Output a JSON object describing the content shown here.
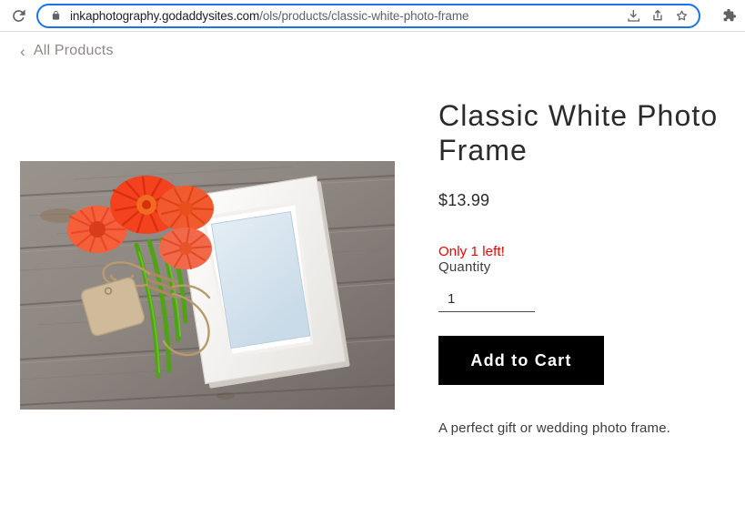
{
  "browser": {
    "reload_icon": "reload-icon",
    "lock_icon": "lock-icon",
    "url_domain": "inkaphotography.godaddysites.com",
    "url_path": "/ols/products/classic-white-photo-frame",
    "url_full": "inkaphotography.godaddysites.com/ols/products/classic-white-photo-frame",
    "download_icon": "download-icon",
    "share_icon": "share-icon",
    "bookmark_icon": "bookmark-star-icon",
    "extensions_icon": "extensions-puzzle-icon",
    "omnibox_focus_color": "#1a73e8"
  },
  "page": {
    "breadcrumb": {
      "chevron": "‹",
      "label": "All Products"
    },
    "product": {
      "image_alt": "Classic white photo frame on weathered gray wood with orange gerbera flowers and a kraft gift tag",
      "title": "Classic White Photo Frame",
      "price": "$13.99",
      "stock_status": "Only 1 left!",
      "stock_status_color": "#ef0000",
      "quantity_label": "Quantity",
      "quantity_value": "1",
      "quantity_placeholder": "1",
      "add_to_cart_label": "Add to Cart",
      "add_to_cart_bg": "#000000",
      "description": "A perfect gift or wedding photo frame."
    }
  }
}
